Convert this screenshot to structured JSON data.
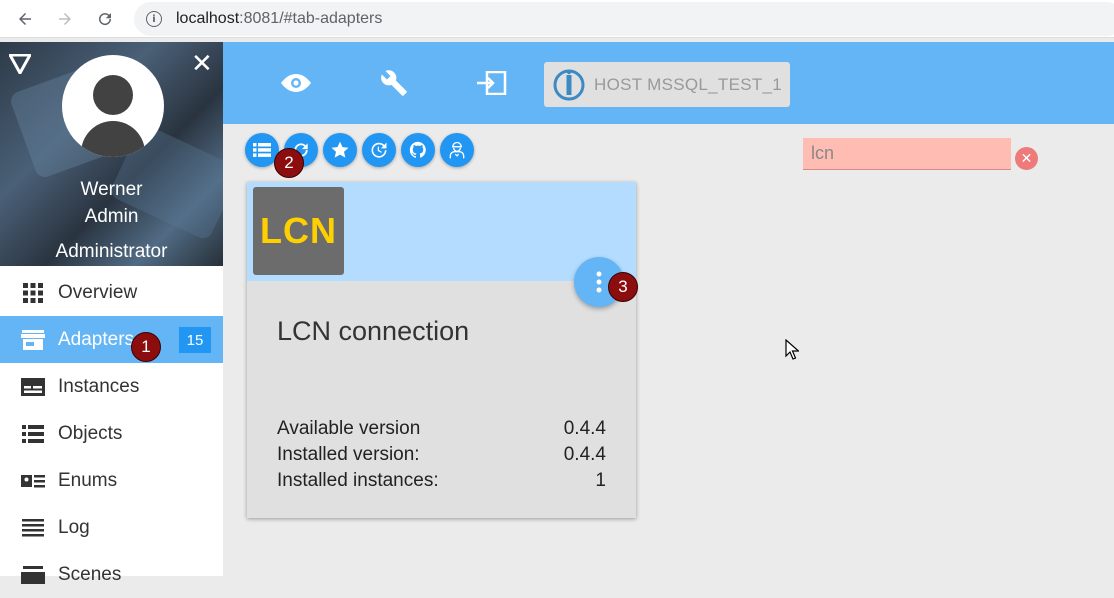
{
  "browser": {
    "url_host": "localhost",
    "url_rest": ":8081/#tab-adapters"
  },
  "sidebar": {
    "profile": {
      "first_name": "Werner",
      "last_name": "Admin",
      "role": "Administrator"
    },
    "items": [
      {
        "label": "Overview",
        "icon": "grid-icon"
      },
      {
        "label": "Adapters",
        "icon": "store-icon",
        "badge": "15",
        "active": true
      },
      {
        "label": "Instances",
        "icon": "instances-icon"
      },
      {
        "label": "Objects",
        "icon": "list-icon"
      },
      {
        "label": "Enums",
        "icon": "enums-icon"
      },
      {
        "label": "Log",
        "icon": "log-icon"
      },
      {
        "label": "Scenes",
        "icon": "scenes-icon"
      }
    ]
  },
  "appbar": {
    "host_label": "HOST MSSQL_TEST_1"
  },
  "toolbar": {
    "buttons": [
      "list-view-icon",
      "refresh-icon",
      "star-icon",
      "update-icon",
      "github-icon",
      "expert-icon"
    ]
  },
  "search": {
    "value": "lcn"
  },
  "card": {
    "logo_text": "LCN",
    "title": "LCN connection",
    "rows": [
      {
        "label": "Available version",
        "value": "0.4.4"
      },
      {
        "label": "Installed version:",
        "value": "0.4.4"
      },
      {
        "label": "Installed instances:",
        "value": "1"
      }
    ]
  },
  "markers": [
    "1",
    "2",
    "3"
  ],
  "colors": {
    "primary": "#64b5f6",
    "accent": "#2196f3",
    "card_header": "#b3dcff",
    "marker": "#8b0d0d",
    "search_bg": "#ffbcb3"
  }
}
